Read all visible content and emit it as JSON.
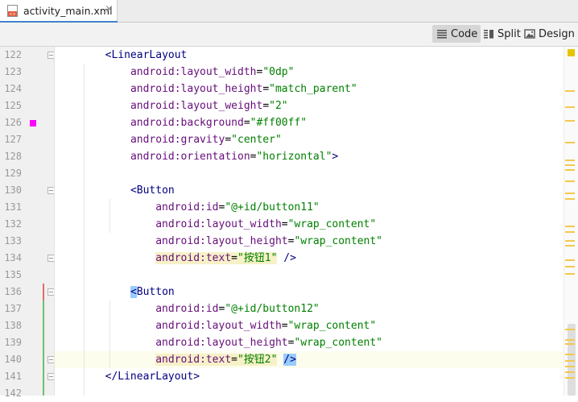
{
  "tab": {
    "label": "activity_main.xml",
    "close": "×",
    "icon": "xml-file-icon"
  },
  "view_modes": [
    {
      "label": "Code",
      "icon": "code-view-icon",
      "active": true
    },
    {
      "label": "Split",
      "icon": "split-view-icon",
      "active": false
    },
    {
      "label": "Design",
      "icon": "design-view-icon",
      "active": false
    }
  ],
  "colors": {
    "tab_accent": "#4083c9",
    "tag": "#000080",
    "attribute": "#660e7a",
    "value": "#008000",
    "swatch": "#ff00ff",
    "current_line": "#fdfdee",
    "warning": "#e8c300"
  },
  "editor": {
    "lines": [
      {
        "n": "122",
        "code": [
          [
            "    ",
            ""
          ],
          [
            "<LinearLayout",
            "tag"
          ]
        ]
      },
      {
        "n": "123",
        "code": [
          [
            "        ",
            ""
          ],
          [
            "android:layout_width",
            "attr"
          ],
          [
            "=",
            ""
          ],
          [
            "\"0dp\"",
            "val"
          ]
        ]
      },
      {
        "n": "124",
        "code": [
          [
            "        ",
            ""
          ],
          [
            "android:layout_height",
            "attr"
          ],
          [
            "=",
            ""
          ],
          [
            "\"match_parent\"",
            "val"
          ]
        ]
      },
      {
        "n": "125",
        "code": [
          [
            "        ",
            ""
          ],
          [
            "android:layout_weight",
            "attr"
          ],
          [
            "=",
            ""
          ],
          [
            "\"2\"",
            "val"
          ]
        ]
      },
      {
        "n": "126",
        "code": [
          [
            "        ",
            ""
          ],
          [
            "android:background",
            "attr"
          ],
          [
            "=",
            ""
          ],
          [
            "\"#ff00ff\"",
            "val"
          ]
        ]
      },
      {
        "n": "127",
        "code": [
          [
            "        ",
            ""
          ],
          [
            "android:gravity",
            "attr"
          ],
          [
            "=",
            ""
          ],
          [
            "\"center\"",
            "val"
          ]
        ]
      },
      {
        "n": "128",
        "code": [
          [
            "        ",
            ""
          ],
          [
            "android:orientation",
            "attr"
          ],
          [
            "=",
            ""
          ],
          [
            "\"horizontal\"",
            "val"
          ],
          [
            ">",
            "tag"
          ]
        ]
      },
      {
        "n": "129",
        "code": []
      },
      {
        "n": "130",
        "code": [
          [
            "        ",
            ""
          ],
          [
            "<Button",
            "tag"
          ]
        ]
      },
      {
        "n": "131",
        "code": [
          [
            "            ",
            ""
          ],
          [
            "android:id",
            "attr"
          ],
          [
            "=",
            ""
          ],
          [
            "\"@+id/button11\"",
            "val"
          ]
        ]
      },
      {
        "n": "132",
        "code": [
          [
            "            ",
            ""
          ],
          [
            "android:layout_width",
            "attr"
          ],
          [
            "=",
            ""
          ],
          [
            "\"wrap_content\"",
            "val"
          ]
        ]
      },
      {
        "n": "133",
        "code": [
          [
            "            ",
            ""
          ],
          [
            "android:layout_height",
            "attr"
          ],
          [
            "=",
            ""
          ],
          [
            "\"wrap_content\"",
            "val"
          ]
        ]
      },
      {
        "n": "134",
        "code": [
          [
            "            ",
            ""
          ],
          [
            "android:text",
            "attr hl-y"
          ],
          [
            "=",
            "hl-y"
          ],
          [
            "\"按钮1\"",
            "val hl-y"
          ],
          [
            " ",
            ""
          ],
          [
            "/>",
            "tag"
          ]
        ]
      },
      {
        "n": "135",
        "code": []
      },
      {
        "n": "136",
        "code": [
          [
            "        ",
            ""
          ],
          [
            "<",
            "tag hl-b"
          ],
          [
            "Button",
            "tag"
          ]
        ]
      },
      {
        "n": "137",
        "code": [
          [
            "            ",
            ""
          ],
          [
            "android:id",
            "attr"
          ],
          [
            "=",
            ""
          ],
          [
            "\"@+id/button12\"",
            "val"
          ]
        ]
      },
      {
        "n": "138",
        "code": [
          [
            "            ",
            ""
          ],
          [
            "android:layout_width",
            "attr"
          ],
          [
            "=",
            ""
          ],
          [
            "\"wrap_content\"",
            "val"
          ]
        ]
      },
      {
        "n": "139",
        "code": [
          [
            "            ",
            ""
          ],
          [
            "android:layout_height",
            "attr"
          ],
          [
            "=",
            ""
          ],
          [
            "\"wrap_content\"",
            "val"
          ]
        ]
      },
      {
        "n": "140",
        "code": [
          [
            "            ",
            ""
          ],
          [
            "android:text",
            "attr hl-y"
          ],
          [
            "=",
            "hl-y"
          ],
          [
            "\"按钮2\"",
            "val hl-y"
          ],
          [
            " ",
            ""
          ],
          [
            "/>",
            "tag hl-b"
          ]
        ]
      },
      {
        "n": "141",
        "code": [
          [
            "    ",
            ""
          ],
          [
            "</LinearLayout>",
            "tag"
          ]
        ]
      },
      {
        "n": "142",
        "code": []
      }
    ],
    "current_line": "140",
    "fold_lines": [
      "122",
      "130",
      "134",
      "136",
      "140",
      "141"
    ],
    "color_swatch_line": "126"
  },
  "scrollbar": {
    "warning_icon": "warning-icon"
  }
}
